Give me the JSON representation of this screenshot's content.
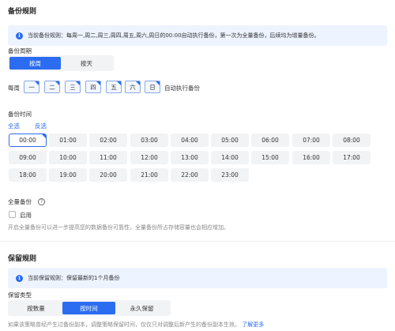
{
  "backup_rules": {
    "title": "备份规则",
    "notice": "当前备份规则：每周一,周二,周三,周四,周五,周六,周日的00:00自动执行备份，第一次为全量备份，后续均为增量备份。",
    "cycle": {
      "label": "备份周期",
      "options": [
        "按周",
        "按天"
      ],
      "selected": "按周"
    },
    "weekdays": {
      "prefix": "每周",
      "days": [
        "一",
        "二",
        "三",
        "四",
        "五",
        "六",
        "日"
      ],
      "suffix": "自动执行备份"
    },
    "time": {
      "label": "备份时间",
      "select_all": "全选",
      "invert": "反选",
      "hours": [
        "00:00",
        "01:00",
        "02:00",
        "03:00",
        "04:00",
        "05:00",
        "06:00",
        "07:00",
        "08:00",
        "09:00",
        "10:00",
        "11:00",
        "12:00",
        "13:00",
        "14:00",
        "15:00",
        "16:00",
        "17:00",
        "18:00",
        "19:00",
        "20:00",
        "21:00",
        "22:00",
        "23:00"
      ],
      "selected": [
        "00:00"
      ]
    },
    "full_backup": {
      "label": "全量备份",
      "help_icon": "question-circle-icon",
      "checkbox_label": "启用",
      "checked": false,
      "description": "开启全量备份可以进一步提高您的数据备份可靠性，全量备份所占存储容量也会相应增加。"
    }
  },
  "retention_rules": {
    "title": "保留规则",
    "notice": "当前保留规则：保留最新的1个月备份",
    "type": {
      "label": "保留类型",
      "options": [
        "按数量",
        "按时间",
        "永久保留"
      ],
      "selected": "按时间"
    },
    "footnote": "如果该策略曾经产生过备份副本，调整策略保留时间，仅仅只对调整后新产生的备份副本生效。",
    "learn_more": "了解更多"
  },
  "colors": {
    "accent": "#2b6cf0",
    "notice_bg": "#edf3ff",
    "chip_bg": "#f2f3f5"
  }
}
